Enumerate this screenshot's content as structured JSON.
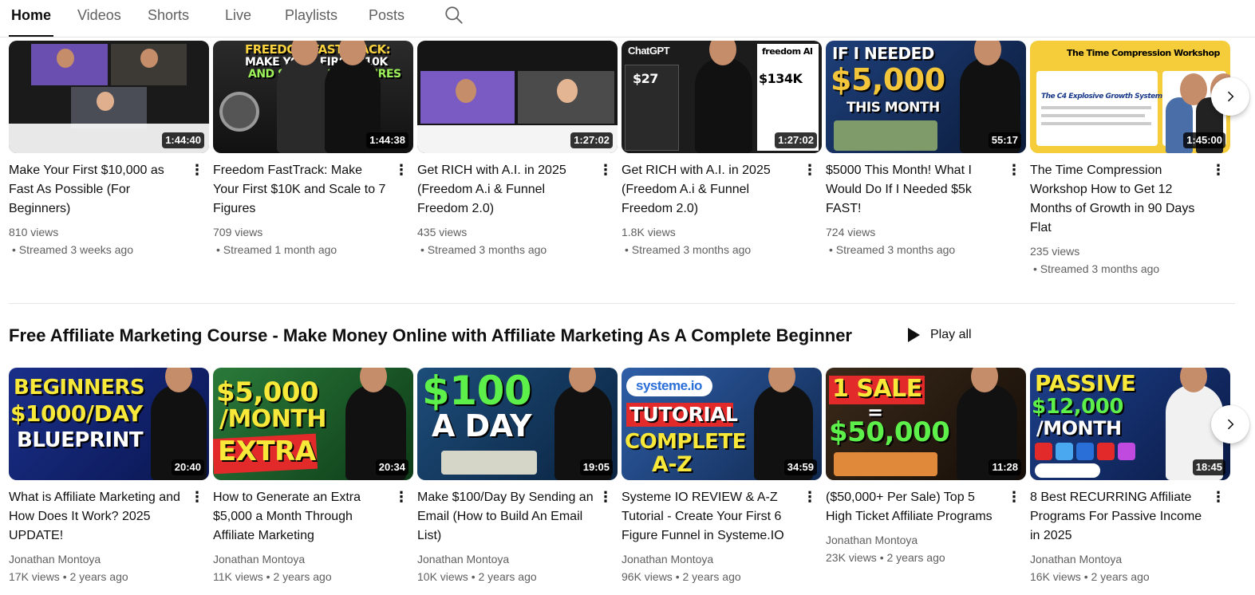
{
  "tabs": [
    "Home",
    "Videos",
    "Shorts",
    "Live",
    "Playlists",
    "Posts"
  ],
  "row1": [
    {
      "title": "Make Your First $10,000 as Fast As Possible (For Beginners)",
      "views": "810 views",
      "time": "• Streamed 3 weeks ago",
      "duration": "1:44:40"
    },
    {
      "title": "Freedom FastTrack: Make Your First $10K and Scale to 7 Figures",
      "views": "709 views",
      "time": "• Streamed 1 month ago",
      "duration": "1:44:38",
      "thumb_text": [
        "FREEDOM FASTTRACK:",
        "MAKE YOUR FIRST $10K",
        "AND SCALE TO 7 FIGURES"
      ]
    },
    {
      "title": "Get RICH with A.I. in 2025 (Freedom A.i & Funnel Freedom 2.0)",
      "views": "435 views",
      "time": "• Streamed 3 months ago",
      "duration": "1:27:02"
    },
    {
      "title": "Get RICH with A.I. in 2025 (Freedom A.i & Funnel Freedom 2.0)",
      "views": "1.8K views",
      "time": "• Streamed 3 months ago",
      "duration": "1:27:02",
      "thumb_text": [
        "ChatGPT",
        "freedom AI",
        "$27",
        "$134K"
      ]
    },
    {
      "title": "$5000 This Month! What I Would Do If I Needed $5k FAST!",
      "views": "724 views",
      "time": "• Streamed 3 months ago",
      "duration": "55:17",
      "thumb_text": [
        "IF I NEEDED",
        "$5,000",
        "THIS MONTH"
      ]
    },
    {
      "title": "The Time Compression Workshop How to Get 12 Months of Growth in 90 Days Flat",
      "views": "235 views",
      "time": "• Streamed 3 months ago",
      "duration": "1:45:00",
      "thumb_text": [
        "The Time Compression Workshop",
        "The C4 Explosive Growth System:"
      ]
    }
  ],
  "section": {
    "title": "Free Affiliate Marketing Course - Make Money Online with Affiliate Marketing As A Complete Beginner",
    "play_all": "Play all"
  },
  "row2": [
    {
      "title": "What is Affiliate Marketing and How Does It Work? 2025 UPDATE!",
      "channel": "Jonathan Montoya",
      "stats": "17K views • 2 years ago",
      "duration": "20:40",
      "thumb_text": [
        "BEGINNERS",
        "$1000/DAY",
        "BLUEPRINT"
      ]
    },
    {
      "title": "How to Generate an Extra $5,000 a Month Through Affiliate Marketing",
      "channel": "Jonathan Montoya",
      "stats": "11K views • 2 years ago",
      "duration": "20:34",
      "thumb_text": [
        "$5,000",
        "/MONTH",
        "EXTRA"
      ]
    },
    {
      "title": "Make $100/Day By Sending an Email (How to Build An Email List)",
      "channel": "Jonathan Montoya",
      "stats": "10K views • 2 years ago",
      "duration": "19:05",
      "thumb_text": [
        "$100",
        "A DAY"
      ]
    },
    {
      "title": "Systeme IO REVIEW & A-Z Tutorial - Create Your First 6 Figure Funnel in Systeme.IO",
      "channel": "Jonathan Montoya",
      "stats": "96K views • 2 years ago",
      "duration": "34:59",
      "thumb_text": [
        "systeme.io",
        "TUTORIAL",
        "COMPLETE",
        "A-Z"
      ]
    },
    {
      "title": "($50,000+ Per Sale) Top 5 High Ticket Affiliate Programs",
      "channel": "Jonathan Montoya",
      "stats": "23K views • 2 years ago",
      "duration": "11:28",
      "thumb_text": [
        "1 SALE",
        "=",
        "$50,000"
      ]
    },
    {
      "title": "8 Best RECURRING Affiliate Programs For Passive Income in 2025",
      "channel": "Jonathan Montoya",
      "stats": "16K views • 2 years ago",
      "duration": "18:45",
      "thumb_text": [
        "PASSIVE",
        "$12,000",
        "/MONTH"
      ]
    }
  ],
  "icons": {
    "search": "search-icon",
    "next": "chevron-right-icon",
    "menu": "more-vert-icon",
    "play": "play-icon"
  },
  "colors": {
    "accent": "#0f0f0f",
    "secondary_text": "#606060",
    "duration_bg": "#000000"
  }
}
